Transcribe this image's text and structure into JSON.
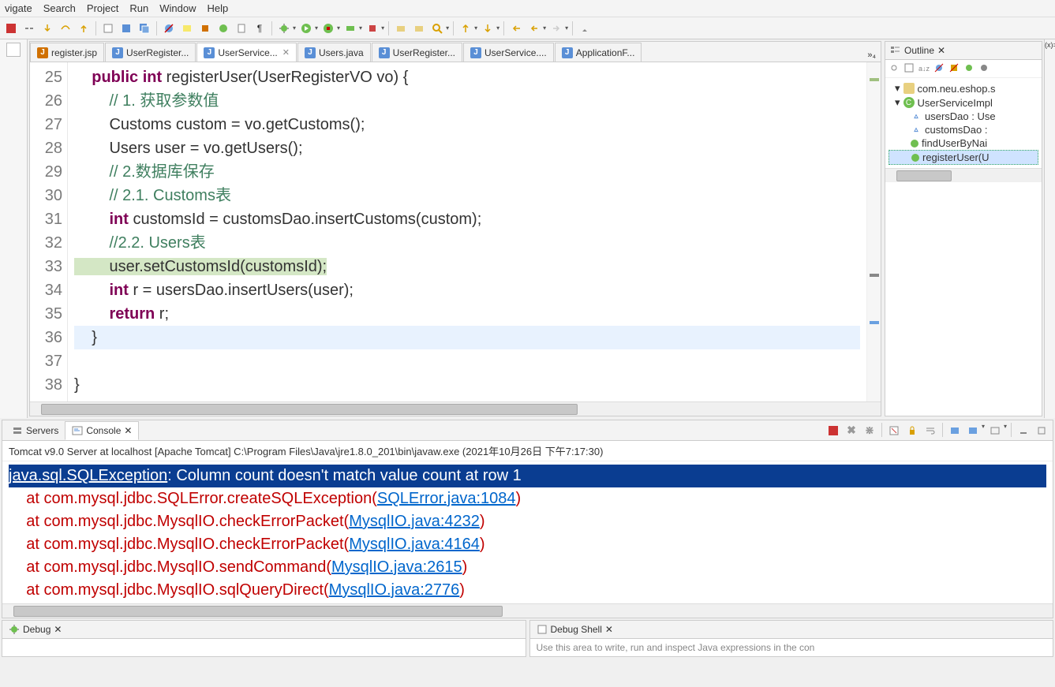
{
  "menu": [
    "vigate",
    "Search",
    "Project",
    "Run",
    "Window",
    "Help"
  ],
  "tabs": [
    {
      "label": "register.jsp",
      "type": "jsp",
      "active": false
    },
    {
      "label": "UserRegister...",
      "type": "java",
      "active": false
    },
    {
      "label": "UserService...",
      "type": "java",
      "active": true,
      "close": true
    },
    {
      "label": "Users.java",
      "type": "java",
      "active": false
    },
    {
      "label": "UserRegister...",
      "type": "java",
      "active": false
    },
    {
      "label": "UserService....",
      "type": "java",
      "active": false
    },
    {
      "label": "ApplicationF...",
      "type": "java",
      "active": false
    }
  ],
  "tab_overflow": "»₄",
  "code": {
    "start": 25,
    "lines": [
      {
        "n": 25,
        "raw": "    public int registerUser(UserRegisterVO vo) {",
        "seg": [
          {
            "t": "    "
          },
          {
            "t": "public",
            "c": "kw"
          },
          {
            "t": " "
          },
          {
            "t": "int",
            "c": "kw"
          },
          {
            "t": " registerUser(UserRegisterVO vo) {"
          }
        ]
      },
      {
        "n": 26,
        "raw": "        // 1. 获取参数值",
        "seg": [
          {
            "t": "        "
          },
          {
            "t": "// 1. 获取参数值",
            "c": "cm"
          }
        ]
      },
      {
        "n": 27,
        "raw": "        Customs custom = vo.getCustoms();",
        "seg": [
          {
            "t": "        Customs custom = vo.getCustoms();"
          }
        ]
      },
      {
        "n": 28,
        "raw": "        Users user = vo.getUsers();",
        "seg": [
          {
            "t": "        Users user = vo.getUsers();"
          }
        ]
      },
      {
        "n": 29,
        "raw": "        // 2.数据库保存",
        "seg": [
          {
            "t": "        "
          },
          {
            "t": "// 2.数据库保存",
            "c": "cm"
          }
        ]
      },
      {
        "n": 30,
        "raw": "        // 2.1. Customs表",
        "seg": [
          {
            "t": "        "
          },
          {
            "t": "// 2.1. Customs表",
            "c": "cm"
          }
        ]
      },
      {
        "n": 31,
        "raw": "        int customsId = customsDao.insertCustoms(custom);",
        "seg": [
          {
            "t": "        "
          },
          {
            "t": "int",
            "c": "kw"
          },
          {
            "t": " customsId = customsDao.insertCustoms(custom);"
          }
        ]
      },
      {
        "n": 32,
        "raw": "        //2.2. Users表",
        "seg": [
          {
            "t": "        "
          },
          {
            "t": "//2.2. Users表",
            "c": "cm"
          }
        ]
      },
      {
        "n": 33,
        "raw": "        user.setCustomsId(customsId);",
        "seg": [
          {
            "t": "        user.setCustomsId(customsId);"
          }
        ],
        "hl": true
      },
      {
        "n": 34,
        "raw": "        int r = usersDao.insertUsers(user);",
        "seg": [
          {
            "t": "        "
          },
          {
            "t": "int",
            "c": "kw"
          },
          {
            "t": " r = usersDao.insertUsers(user);"
          }
        ]
      },
      {
        "n": 35,
        "raw": "        return r;",
        "seg": [
          {
            "t": "        "
          },
          {
            "t": "return",
            "c": "kw"
          },
          {
            "t": " r;"
          }
        ]
      },
      {
        "n": 36,
        "raw": "    }",
        "seg": [
          {
            "t": "    }"
          }
        ],
        "cur": true
      },
      {
        "n": 37,
        "raw": "",
        "seg": [
          {
            "t": " "
          }
        ]
      },
      {
        "n": 38,
        "raw": "}",
        "seg": [
          {
            "t": "}"
          }
        ]
      }
    ]
  },
  "outline": {
    "title": "Outline",
    "pkg": "com.neu.eshop.s",
    "cls": "UserServiceImpl",
    "members": [
      {
        "k": "fld",
        "label": "usersDao : Use"
      },
      {
        "k": "fld",
        "label": "customsDao :"
      },
      {
        "k": "mth",
        "label": "findUserByNai"
      },
      {
        "k": "mth",
        "label": "registerUser(U",
        "sel": true
      }
    ]
  },
  "console": {
    "tabs": [
      "Servers",
      "Console"
    ],
    "active": 1,
    "status": "Tomcat v9.0 Server at localhost [Apache Tomcat] C:\\Program Files\\Java\\jre1.8.0_201\\bin\\javaw.exe (2021年10月26日 下午7:17:30)",
    "lines": [
      {
        "sel": true,
        "parts": [
          {
            "t": "java.sql.SQLException",
            "u": true
          },
          {
            "t": ": Column count doesn't match value count at row 1"
          }
        ]
      },
      {
        "parts": [
          {
            "t": "    at com.mysql.jdbc.SQLError.createSQLException("
          },
          {
            "t": "SQLError.java:1084",
            "link": true
          },
          {
            "t": ")"
          }
        ]
      },
      {
        "parts": [
          {
            "t": "    at com.mysql.jdbc.MysqlIO.checkErrorPacket("
          },
          {
            "t": "MysqlIO.java:4232",
            "link": true
          },
          {
            "t": ")"
          }
        ]
      },
      {
        "parts": [
          {
            "t": "    at com.mysql.jdbc.MysqlIO.checkErrorPacket("
          },
          {
            "t": "MysqlIO.java:4164",
            "link": true
          },
          {
            "t": ")"
          }
        ]
      },
      {
        "parts": [
          {
            "t": "    at com.mysql.jdbc.MysqlIO.sendCommand("
          },
          {
            "t": "MysqlIO.java:2615",
            "link": true
          },
          {
            "t": ")"
          }
        ]
      },
      {
        "parts": [
          {
            "t": "    at com.mysql.jdbc.MysqlIO.sqlQueryDirect("
          },
          {
            "t": "MysqlIO.java:2776",
            "link": true
          },
          {
            "t": ")"
          }
        ]
      }
    ]
  },
  "bottom": {
    "debug": "Debug",
    "shell": "Debug Shell",
    "hint": "Use this area to write, run and inspect Java expressions in the con"
  }
}
